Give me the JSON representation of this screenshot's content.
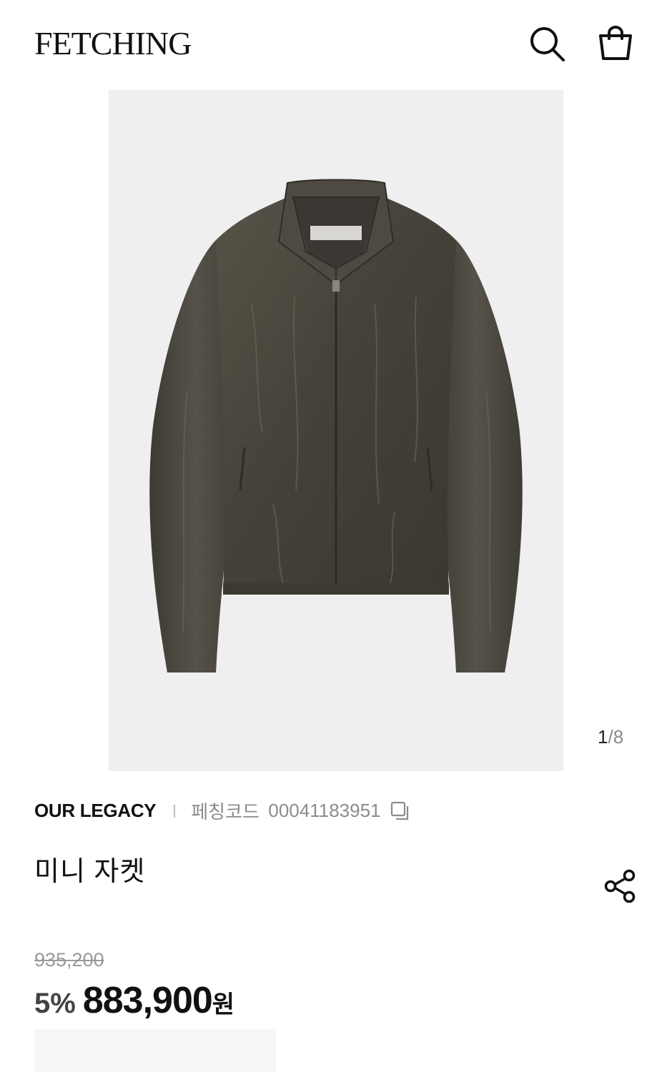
{
  "header": {
    "logo": "FETCHING",
    "icons": {
      "search": "search-icon",
      "cart": "shopping-bag-icon"
    }
  },
  "gallery": {
    "image_subject": "jacket",
    "current": "1",
    "separator": "/",
    "total": "8"
  },
  "product": {
    "brand": "OUR LEGACY",
    "code_label": "페칭코드",
    "code": "00041183951",
    "name": "미니 자켓",
    "original_price": "935,200",
    "discount": "5%",
    "price": "883,900",
    "currency": "원"
  },
  "colors": {
    "text": "#111111",
    "muted": "#8c8c8c",
    "discount": "#444444",
    "image_bg": "#f0f0f0",
    "jacket": "#4a463d"
  }
}
